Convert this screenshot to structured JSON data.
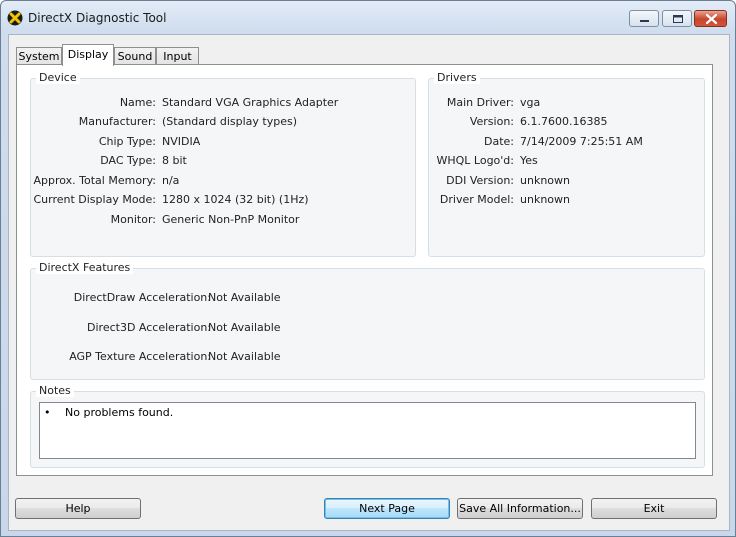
{
  "window": {
    "title": "DirectX Diagnostic Tool"
  },
  "tabs": [
    {
      "label": "System"
    },
    {
      "label": "Display"
    },
    {
      "label": "Sound"
    },
    {
      "label": "Input"
    }
  ],
  "active_tab": "Display",
  "device": {
    "title": "Device",
    "rows": [
      {
        "label": "Name:",
        "value": "Standard VGA Graphics Adapter"
      },
      {
        "label": "Manufacturer:",
        "value": "(Standard display types)"
      },
      {
        "label": "Chip Type:",
        "value": "NVIDIA"
      },
      {
        "label": "DAC Type:",
        "value": "8 bit"
      },
      {
        "label": "Approx. Total Memory:",
        "value": "n/a"
      },
      {
        "label": "Current Display Mode:",
        "value": "1280 x 1024 (32 bit) (1Hz)"
      },
      {
        "label": "Monitor:",
        "value": "Generic Non-PnP Monitor"
      }
    ]
  },
  "drivers": {
    "title": "Drivers",
    "rows": [
      {
        "label": "Main Driver:",
        "value": "vga"
      },
      {
        "label": "Version:",
        "value": "6.1.7600.16385"
      },
      {
        "label": "Date:",
        "value": "7/14/2009 7:25:51 AM"
      },
      {
        "label": "WHQL Logo'd:",
        "value": "Yes"
      },
      {
        "label": "DDI Version:",
        "value": "unknown"
      },
      {
        "label": "Driver Model:",
        "value": "unknown"
      }
    ]
  },
  "features": {
    "title": "DirectX Features",
    "rows": [
      {
        "label": "DirectDraw Acceleration:",
        "value": "Not Available"
      },
      {
        "label": "Direct3D Acceleration:",
        "value": "Not Available"
      },
      {
        "label": "AGP Texture Acceleration:",
        "value": "Not Available"
      }
    ]
  },
  "notes": {
    "title": "Notes",
    "bullet": "•",
    "items": [
      "No problems found."
    ]
  },
  "buttons": {
    "help": "Help",
    "next_page": "Next Page",
    "save_all": "Save All Information...",
    "exit": "Exit"
  }
}
